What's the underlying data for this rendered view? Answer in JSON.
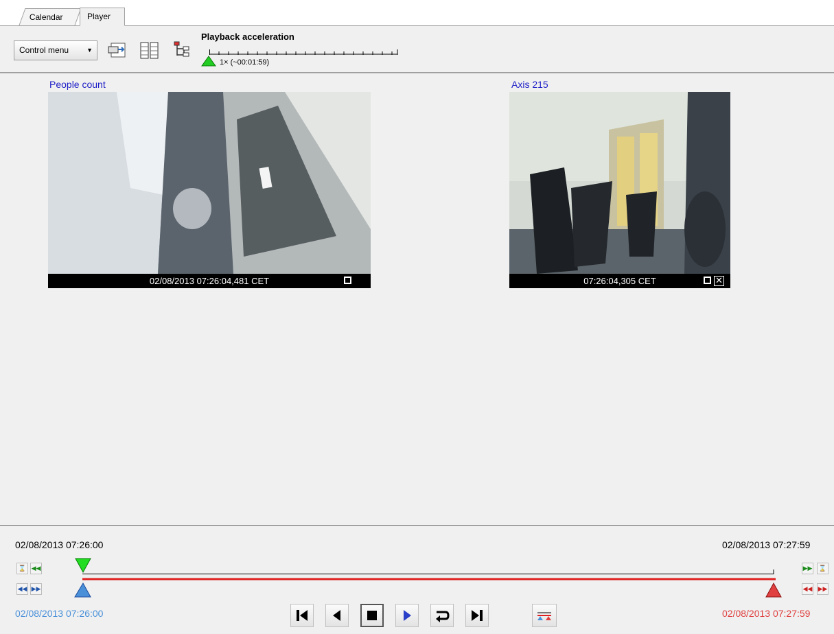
{
  "tabs": [
    {
      "label": "Calendar"
    },
    {
      "label": "Player"
    }
  ],
  "toolbar": {
    "control_menu_label": "Control menu",
    "playback_acceleration_label": "Playback acceleration",
    "acceleration_value": "1× (~00:01:59)"
  },
  "cameras": [
    {
      "title": "People count",
      "timestamp": "02/08/2013 07:26:04,481 CET"
    },
    {
      "title": "Axis 215",
      "timestamp": "07:26:04,305 CET"
    }
  ],
  "timeline": {
    "range_start": "02/08/2013 07:26:00",
    "range_end": "02/08/2013 07:27:59",
    "selection_start": "02/08/2013 07:26:00",
    "selection_end": "02/08/2013 07:27:59",
    "position_fraction": 0.0,
    "colors": {
      "start": "#4a90d9",
      "end": "#e04040",
      "position": "#2cc62c",
      "track": "#e02020"
    }
  },
  "icons": [
    "dropdown-arrow-icon",
    "export-icon",
    "layout-columns-icon",
    "camera-tree-icon",
    "go-to-start-icon",
    "step-back-icon",
    "stop-icon",
    "play-icon",
    "loop-icon",
    "go-to-end-icon",
    "sync-markers-icon"
  ]
}
